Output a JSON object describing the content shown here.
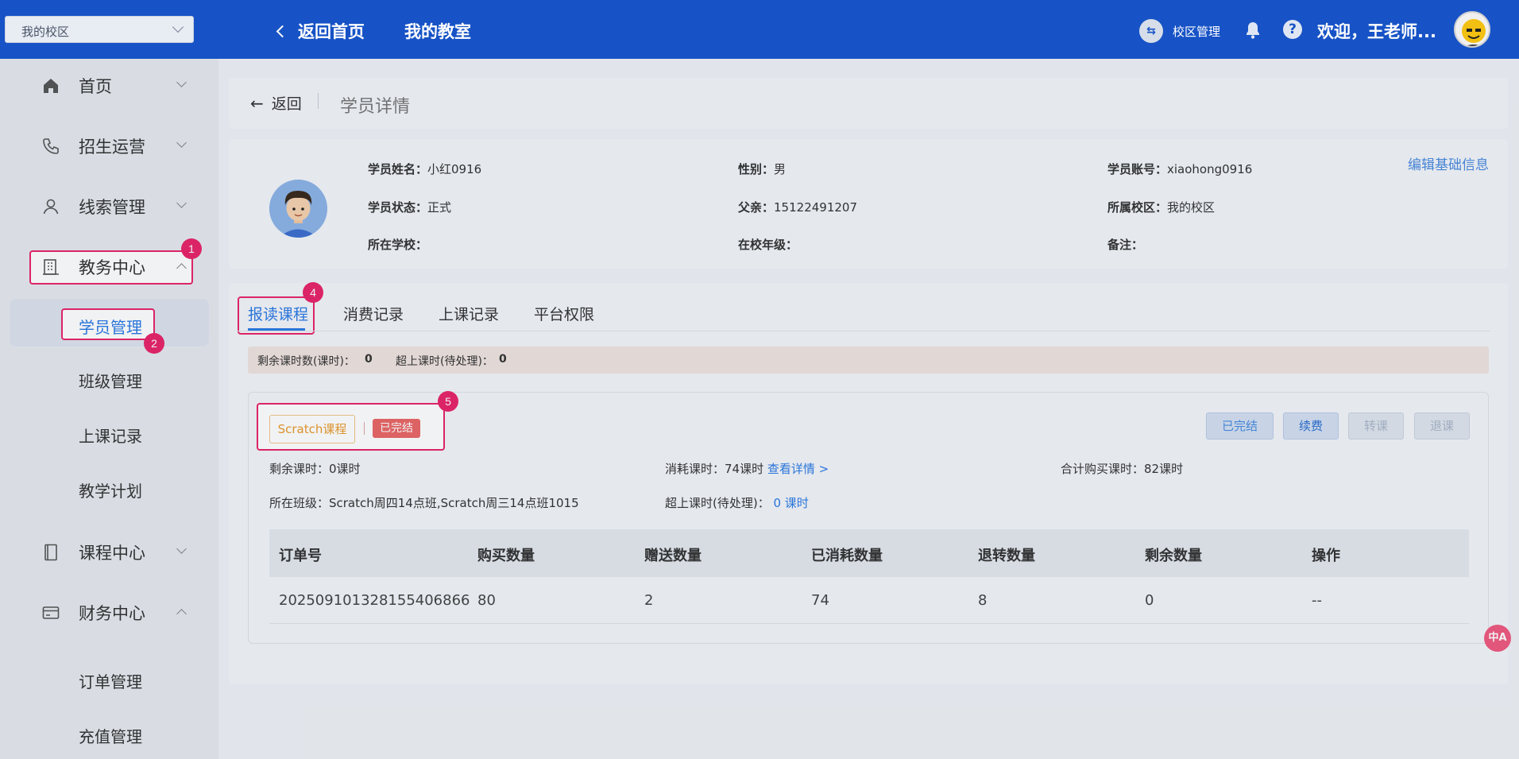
{
  "header": {
    "campus_select": "我的校区",
    "back_home": "返回首页",
    "my_classroom": "我的教室",
    "campus_manage": "校区管理",
    "welcome": "欢迎，王老师...",
    "brand_color": "#1753c6"
  },
  "sidebar": {
    "items": [
      {
        "label": "首页",
        "icon": "home-icon"
      },
      {
        "label": "招生运营",
        "icon": "phone-icon"
      },
      {
        "label": "线索管理",
        "icon": "user-icon"
      },
      {
        "label": "教务中心",
        "icon": "building-icon",
        "badge": "1"
      },
      {
        "label": "课程中心",
        "icon": "book-icon"
      },
      {
        "label": "财务中心",
        "icon": "card-icon"
      }
    ],
    "sub_items": {
      "student_manage": "学员管理",
      "student_badge": "2",
      "class_manage": "班级管理",
      "lesson_records": "上课记录",
      "teaching_plan": "教学计划",
      "order_manage": "订单管理",
      "recharge_manage": "充值管理"
    }
  },
  "page": {
    "back": "返回",
    "title": "学员详情"
  },
  "student": {
    "name_label": "学员姓名：",
    "name": "小红0916",
    "gender_label": "性别：",
    "gender": "男",
    "account_label": "学员账号：",
    "account": "xiaohong0916",
    "status_label": "学员状态：",
    "status": "正式",
    "father_label": "父亲：",
    "father": "15122491207",
    "campus_label": "所属校区：",
    "campus": "我的校区",
    "school_label": "所在学校：",
    "grade_label": "在校年级：",
    "remark_label": "备注：",
    "edit": "编辑基础信息"
  },
  "tabs": {
    "enrolled": "报读课程",
    "consume": "消费记录",
    "lessons": "上课记录",
    "platform": "平台权限",
    "enrolled_badge": "4"
  },
  "hours_summary": {
    "remaining_label": "剩余课时数(课时)：",
    "remaining": "0",
    "over_label": "超上课时(待处理)：",
    "over": "0"
  },
  "course": {
    "name": "Scratch课程",
    "status": "已完结",
    "badge": "5",
    "btn_done": "已完结",
    "btn_renew": "续费",
    "btn_transfer": "转课",
    "btn_refund": "退课",
    "remaining": "剩余课时：0课时",
    "consumed": "消耗课时：74课时",
    "view_detail": "查看详情 >",
    "total": "合计购买课时：82课时",
    "classes": "所在班级：Scratch周四14点班,Scratch周三14点班1015",
    "over_label": "超上课时(待处理)：",
    "over_value": "0 课时"
  },
  "table": {
    "headers": [
      "订单号",
      "购买数量",
      "赠送数量",
      "已消耗数量",
      "退转数量",
      "剩余数量",
      "操作"
    ],
    "rows": [
      [
        "20250910132815540686​6",
        "80",
        "2",
        "74",
        "8",
        "0",
        "--"
      ]
    ]
  },
  "badges": {
    "one": "1",
    "two": "2"
  }
}
